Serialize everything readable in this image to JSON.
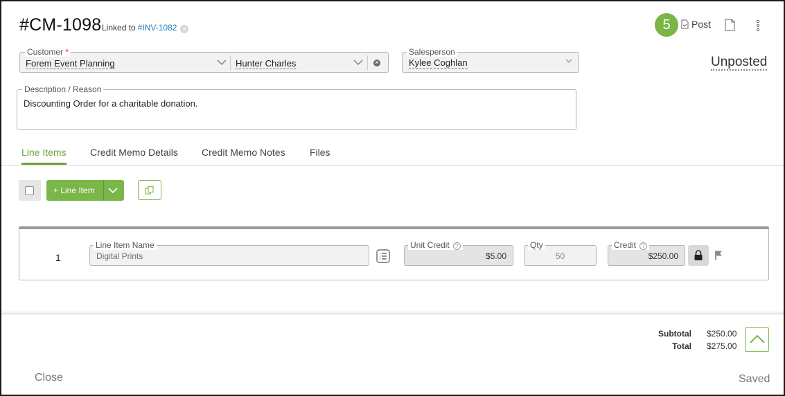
{
  "header": {
    "title": "#CM-1098",
    "linked_prefix": "Linked to",
    "linked_ref": "#INV-1082",
    "step_badge": "5",
    "post_label": "Post",
    "pdf_label": "PDF",
    "status": "Unposted"
  },
  "customer": {
    "label": "Customer",
    "required_mark": "*",
    "value": "Forem Event Planning",
    "contact": "Hunter Charles"
  },
  "salesperson": {
    "label": "Salesperson",
    "value": "Kylee Coghlan"
  },
  "description": {
    "label": "Description / Reason",
    "value": "Discounting Order for a charitable donation."
  },
  "tabs": [
    {
      "label": "Line Items",
      "active": true
    },
    {
      "label": "Credit Memo Details",
      "active": false
    },
    {
      "label": "Credit Memo Notes",
      "active": false
    },
    {
      "label": "Files",
      "active": false
    }
  ],
  "toolbar": {
    "add_label": "+ Line Item"
  },
  "line_items": [
    {
      "number": "1",
      "name_label": "Line Item Name",
      "name": "Digital Prints",
      "unit_credit_label": "Unit Credit",
      "unit_credit": "$5.00",
      "qty_label": "Qty",
      "qty": "50",
      "credit_label": "Credit",
      "credit": "$250.00"
    }
  ],
  "totals": {
    "subtotal_label": "Subtotal",
    "subtotal": "$250.00",
    "total_label": "Total",
    "total": "$275.00"
  },
  "footer": {
    "close_label": "Close",
    "saved_label": "Saved"
  },
  "colors": {
    "accent": "#7ab648",
    "link": "#1f7fc4"
  }
}
